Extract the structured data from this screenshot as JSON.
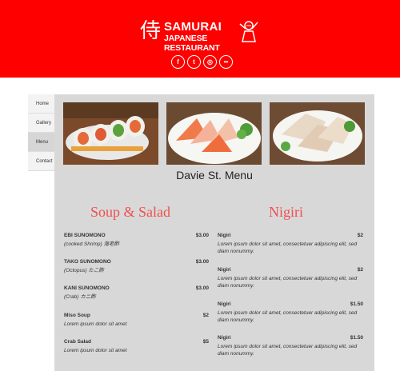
{
  "brand": {
    "kanji": "侍",
    "name": "SAMURAI",
    "tagline": "JAPANESE RESTAURANT"
  },
  "social": [
    {
      "icon": "facebook-icon",
      "glyph": "f"
    },
    {
      "icon": "twitter-icon",
      "glyph": "t"
    },
    {
      "icon": "instagram-icon",
      "glyph": "◎"
    },
    {
      "icon": "flickr-icon",
      "glyph": "••"
    }
  ],
  "nav": [
    "Home",
    "Gallery",
    "Menu",
    "Contact"
  ],
  "active_nav": "Menu",
  "page_title": "Davie St. Menu",
  "left": {
    "heading": "Soup & Salad",
    "items": [
      {
        "name": "EBI SUNOMONO",
        "price": "$3.00",
        "desc": "(cooked Shrimp) 海老酢"
      },
      {
        "name": "TAKO SUNOMONO",
        "price": "$3.00",
        "desc": "(Octopus) たこ酢"
      },
      {
        "name": "KANI SUNOMONO",
        "price": "$3.00",
        "desc": "(Crab) カニ酢"
      },
      {
        "name": "Miso Soup",
        "price": "$2",
        "desc": "Lorem ipsum dolor sit amet"
      },
      {
        "name": "Crab Salad",
        "price": "$5",
        "desc": "Lorem ipsum dolor sit amet"
      }
    ]
  },
  "right": {
    "heading": "Nigiri",
    "items": [
      {
        "name": "Nigiri",
        "price": "$2",
        "desc": "Lorem ipsum dolor sit amet, consectetuer adipiscing elit, sed diam nonummy."
      },
      {
        "name": "Nigiri",
        "price": "$2",
        "desc": "Lorem ipsum dolor sit amet, consectetuer adipiscing elit, sed diam nonummy."
      },
      {
        "name": "Nigiri",
        "price": "$1.50",
        "desc": "Lorem ipsum dolor sit amet, consectetuer adipiscing elit, sed diam nonummy."
      },
      {
        "name": "Nigiri",
        "price": "$1.50",
        "desc": "Lorem ipsum dolor sit amet, consectetuer adipiscing elit, sed diam nonummy."
      }
    ]
  },
  "colors": {
    "header": "#fe0000",
    "section_heading": "#f25050",
    "panel": "#d8d8d8"
  }
}
